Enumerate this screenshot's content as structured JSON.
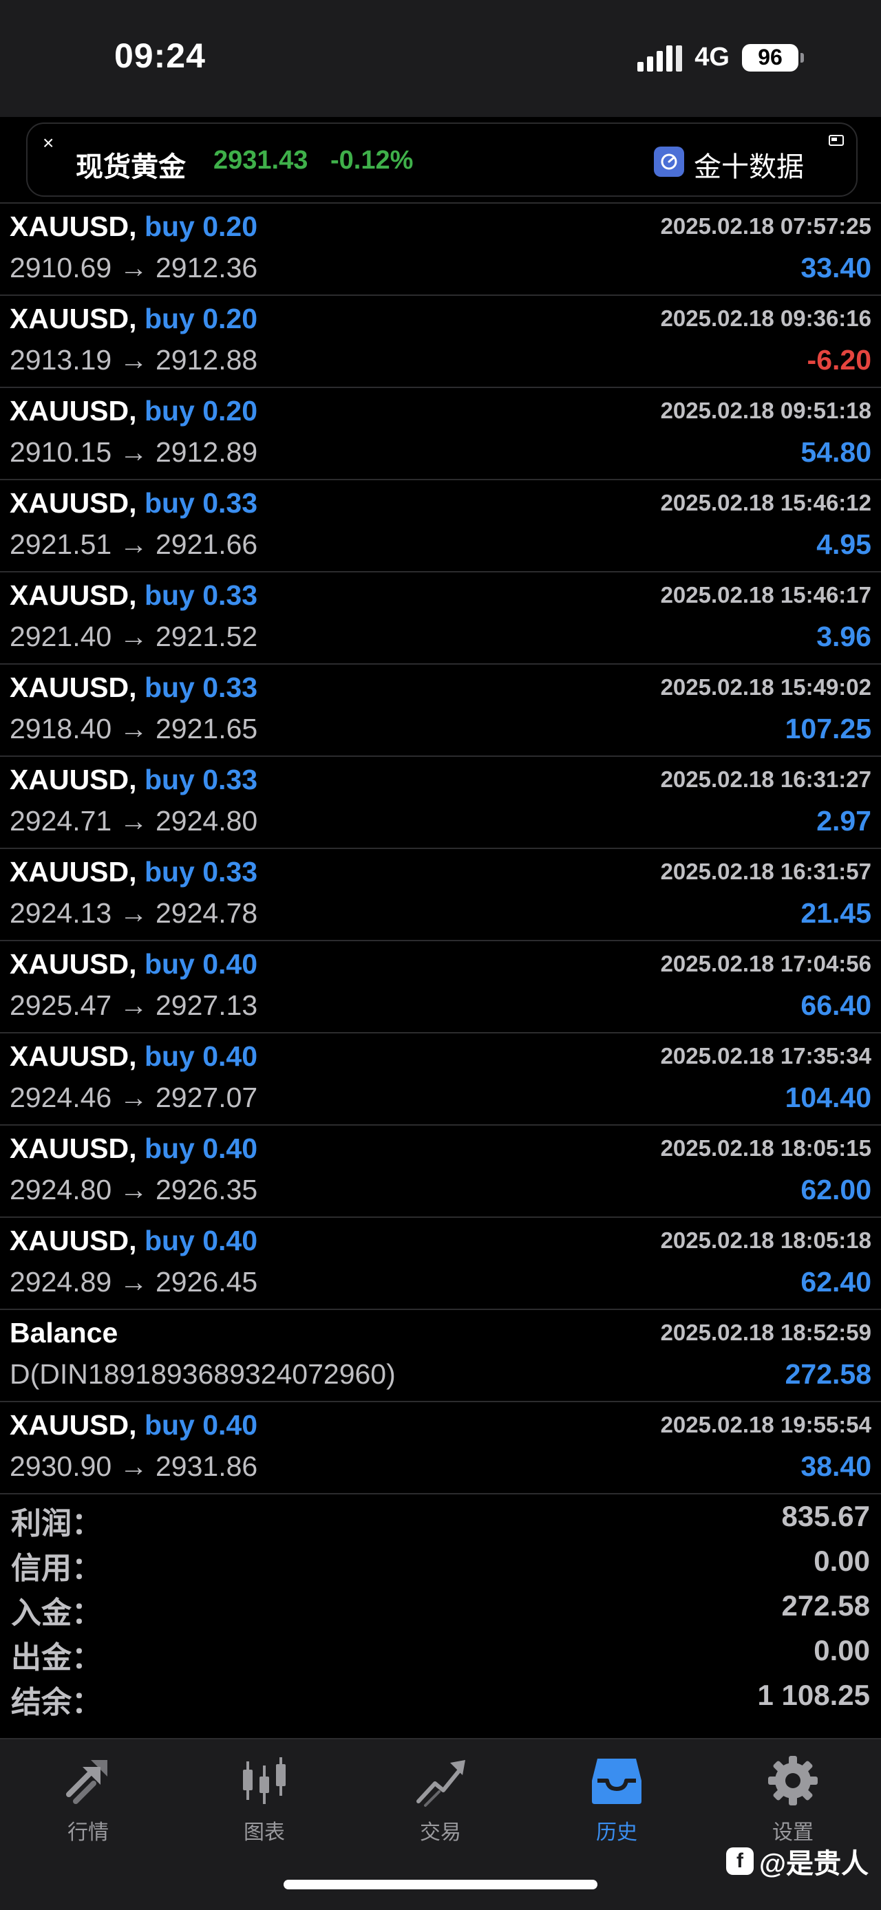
{
  "status": {
    "time": "09:24",
    "network": "4G",
    "battery": "96"
  },
  "ticker": {
    "close_glyph": "×",
    "name": "现货黄金",
    "price": "2931.43",
    "change": "-0.12%",
    "brand": "金十数据",
    "price_color": "#3fb04a"
  },
  "deals": [
    {
      "symbol": "XAUUSD,",
      "side": "buy 0.20",
      "time": "2025.02.18 07:57:25",
      "prices": "2910.69 → 2912.36",
      "profit": "33.40",
      "negative": false
    },
    {
      "symbol": "XAUUSD,",
      "side": "buy 0.20",
      "time": "2025.02.18 09:36:16",
      "prices": "2913.19 → 2912.88",
      "profit": "-6.20",
      "negative": true
    },
    {
      "symbol": "XAUUSD,",
      "side": "buy 0.20",
      "time": "2025.02.18 09:51:18",
      "prices": "2910.15 → 2912.89",
      "profit": "54.80",
      "negative": false
    },
    {
      "symbol": "XAUUSD,",
      "side": "buy 0.33",
      "time": "2025.02.18 15:46:12",
      "prices": "2921.51 → 2921.66",
      "profit": "4.95",
      "negative": false
    },
    {
      "symbol": "XAUUSD,",
      "side": "buy 0.33",
      "time": "2025.02.18 15:46:17",
      "prices": "2921.40 → 2921.52",
      "profit": "3.96",
      "negative": false
    },
    {
      "symbol": "XAUUSD,",
      "side": "buy 0.33",
      "time": "2025.02.18 15:49:02",
      "prices": "2918.40 → 2921.65",
      "profit": "107.25",
      "negative": false
    },
    {
      "symbol": "XAUUSD,",
      "side": "buy 0.33",
      "time": "2025.02.18 16:31:27",
      "prices": "2924.71 → 2924.80",
      "profit": "2.97",
      "negative": false
    },
    {
      "symbol": "XAUUSD,",
      "side": "buy 0.33",
      "time": "2025.02.18 16:31:57",
      "prices": "2924.13 → 2924.78",
      "profit": "21.45",
      "negative": false
    },
    {
      "symbol": "XAUUSD,",
      "side": "buy 0.40",
      "time": "2025.02.18 17:04:56",
      "prices": "2925.47 → 2927.13",
      "profit": "66.40",
      "negative": false
    },
    {
      "symbol": "XAUUSD,",
      "side": "buy 0.40",
      "time": "2025.02.18 17:35:34",
      "prices": "2924.46 → 2927.07",
      "profit": "104.40",
      "negative": false
    },
    {
      "symbol": "XAUUSD,",
      "side": "buy 0.40",
      "time": "2025.02.18 18:05:15",
      "prices": "2924.80 → 2926.35",
      "profit": "62.00",
      "negative": false
    },
    {
      "symbol": "XAUUSD,",
      "side": "buy 0.40",
      "time": "2025.02.18 18:05:18",
      "prices": "2924.89 → 2926.45",
      "profit": "62.40",
      "negative": false
    },
    {
      "symbol": "Balance",
      "side": "",
      "time": "2025.02.18 18:52:59",
      "prices": "D(DIN1891893689324072960)",
      "profit": "272.58",
      "negative": false
    },
    {
      "symbol": "XAUUSD,",
      "side": "buy 0.40",
      "time": "2025.02.18 19:55:54",
      "prices": "2930.90 → 2931.86",
      "profit": "38.40",
      "negative": false
    }
  ],
  "summary": [
    {
      "label": "利润：",
      "value": "835.67"
    },
    {
      "label": "信用：",
      "value": "0.00"
    },
    {
      "label": "入金：",
      "value": "272.58"
    },
    {
      "label": "出金：",
      "value": "0.00"
    },
    {
      "label": "结余：",
      "value": "1 108.25"
    }
  ],
  "tabs": [
    {
      "label": "行情",
      "icon": "quotes-arrows-icon",
      "active": false
    },
    {
      "label": "图表",
      "icon": "candlestick-chart-icon",
      "active": false
    },
    {
      "label": "交易",
      "icon": "trade-chart-icon",
      "active": false
    },
    {
      "label": "历史",
      "icon": "history-inbox-icon",
      "active": true
    },
    {
      "label": "设置",
      "icon": "gear-icon",
      "active": false
    }
  ],
  "watermark": {
    "logo_glyph": "f",
    "text": "@是贵人"
  },
  "colors": {
    "accent_blue": "#3a8ef0",
    "loss_red": "#e5453f",
    "gain_green": "#3fb04a",
    "background": "#000000",
    "bar_background": "#1c1c1e"
  }
}
